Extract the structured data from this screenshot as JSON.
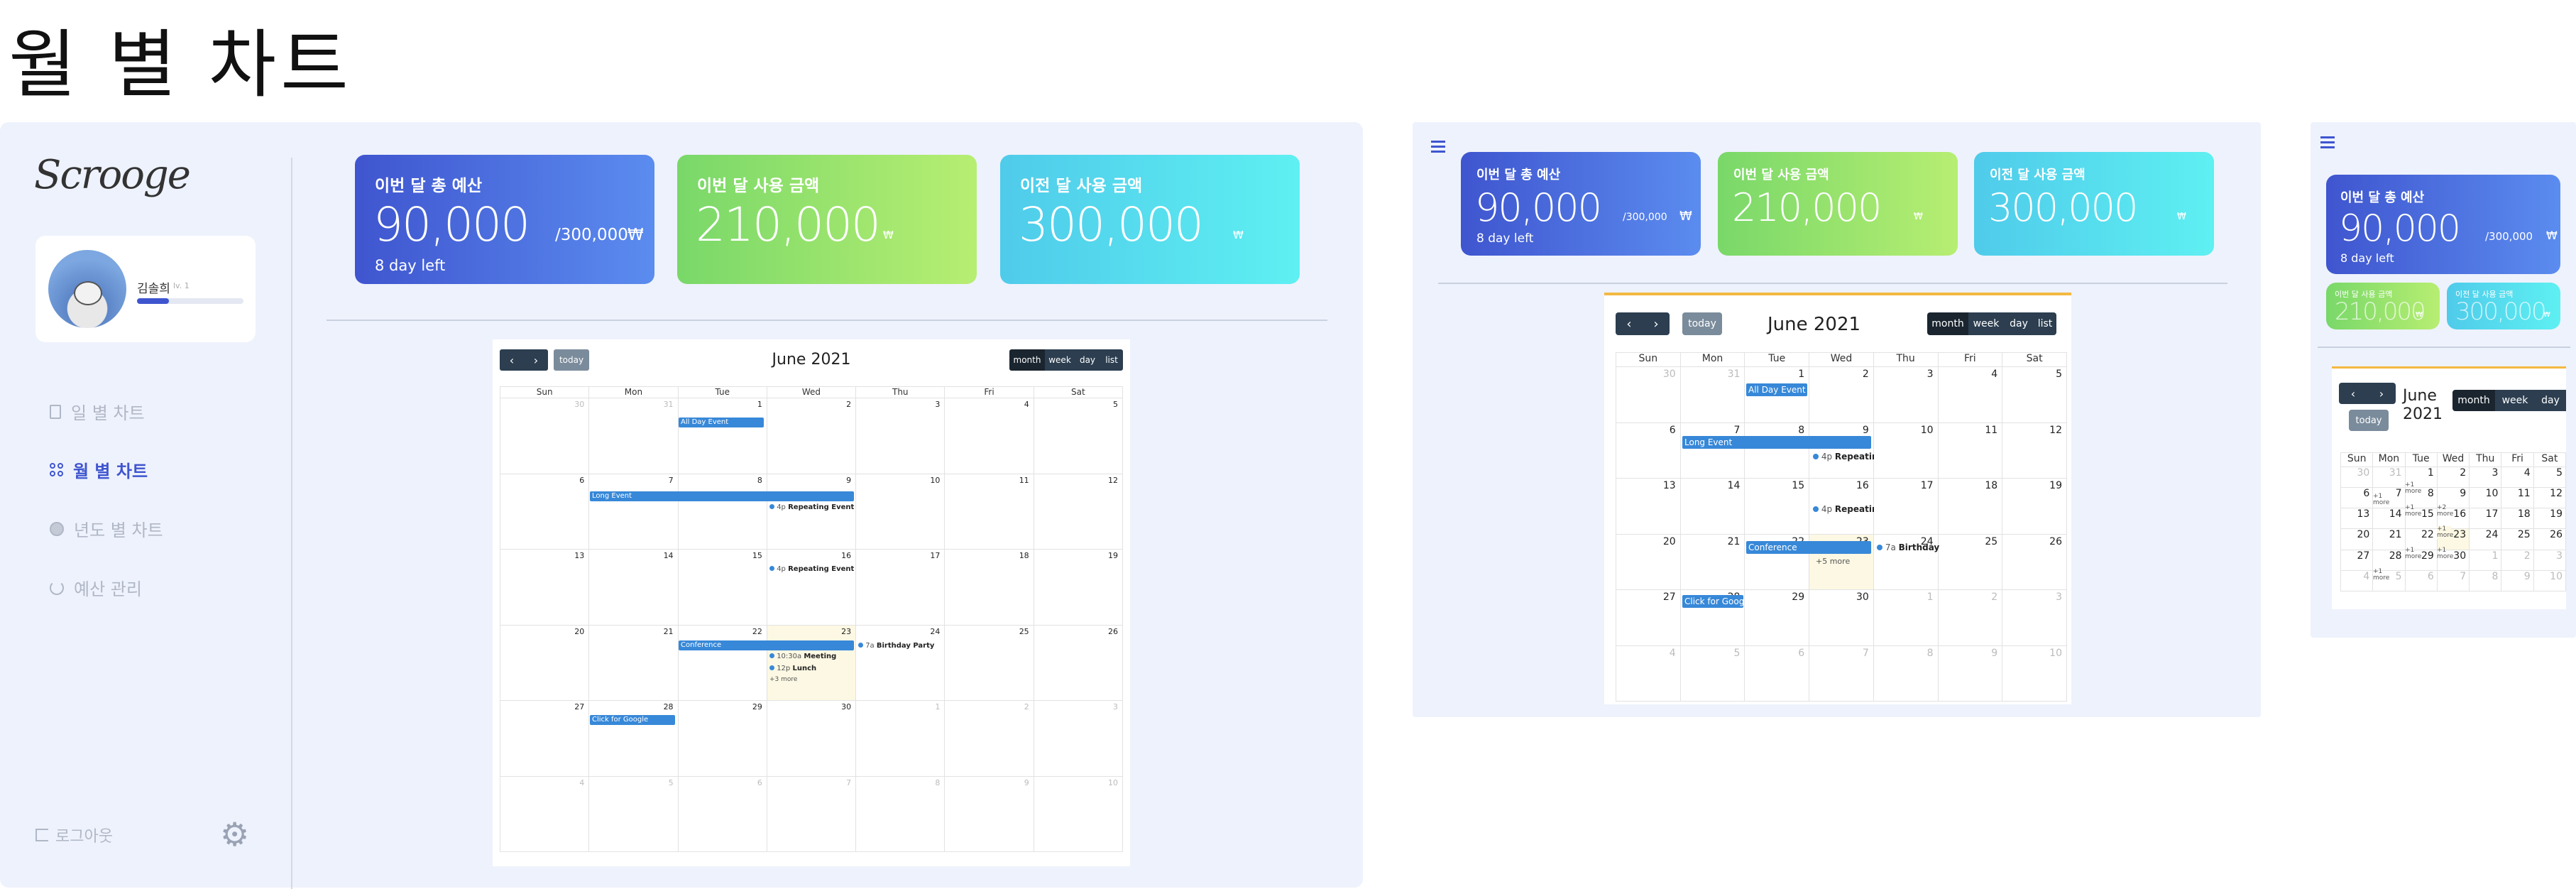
{
  "page_title": "월 별 차트",
  "app": {
    "logo": "Scrooge",
    "user": {
      "name": "김솔희",
      "level": "lv. 1",
      "progress": 0.3
    },
    "nav": [
      {
        "label": "일 별 차트",
        "icon": "document-icon",
        "active": false
      },
      {
        "label": "월 별 차트",
        "icon": "grid-icon",
        "active": true
      },
      {
        "label": "년도 별 차트",
        "icon": "globe-icon",
        "active": false
      },
      {
        "label": "예산 관리",
        "icon": "pie-icon",
        "active": false
      }
    ],
    "logout": "로그아웃",
    "settings_icon": "gear-icon",
    "menu_icon": "hamburger-icon"
  },
  "cards": {
    "budget": {
      "title": "이번 달 총 예산",
      "amount": "90,000",
      "total": "/300,000",
      "currency": "₩",
      "days_left": "8 day left"
    },
    "spent": {
      "title": "이번 달 사용 금액",
      "amount": "210,000",
      "currency": "₩"
    },
    "prev": {
      "title": "이전 달 사용 금액",
      "amount": "300,000",
      "currency": "₩"
    }
  },
  "calendar": {
    "title": "June 2021",
    "title_line1": "June",
    "title_line2": "2021",
    "today_label": "today",
    "views": [
      "month",
      "week",
      "day",
      "list"
    ],
    "days": [
      "Sun",
      "Mon",
      "Tue",
      "Wed",
      "Thu",
      "Fri",
      "Sat"
    ],
    "weeks": [
      [
        "30",
        "31",
        "1",
        "2",
        "3",
        "4",
        "5"
      ],
      [
        "6",
        "7",
        "8",
        "9",
        "10",
        "11",
        "12"
      ],
      [
        "13",
        "14",
        "15",
        "16",
        "17",
        "18",
        "19"
      ],
      [
        "20",
        "21",
        "22",
        "23",
        "24",
        "25",
        "26"
      ],
      [
        "27",
        "28",
        "29",
        "30",
        "1",
        "2",
        "3"
      ],
      [
        "4",
        "5",
        "6",
        "7",
        "8",
        "9",
        "10"
      ]
    ],
    "events": {
      "all_day": "All Day Event",
      "long": "Long Event",
      "repeat_time": "4p",
      "repeat_title": "Repeating Event",
      "repeat_title_short": "Repeatin",
      "conference": "Conference",
      "meeting_time": "10:30a",
      "meeting_title": "Meeting",
      "lunch_time": "12p",
      "lunch_title": "Lunch",
      "more5": "+5 more",
      "more3": "+3 more",
      "more1": "+1 more",
      "more2": "+2 more",
      "bday_time": "7a",
      "bday_title": "Birthday Party",
      "bday_title_short": "Birthday",
      "google": "Click for Google",
      "google_short": "Click for Googl"
    }
  },
  "colors": {
    "accent": "#3f55cf",
    "event": "#3788d8",
    "dark": "#2c3e50",
    "panel": "#eef2fc"
  }
}
